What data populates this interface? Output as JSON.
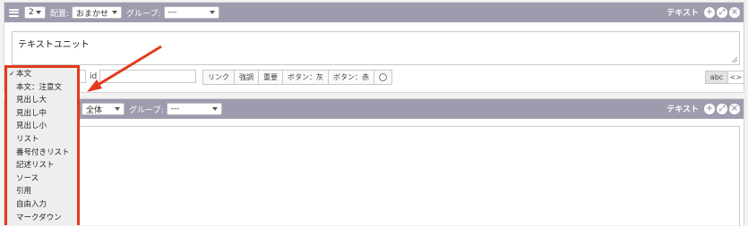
{
  "unit1": {
    "count": "2",
    "placement_label": "配置:",
    "placement_value": "おまかせ",
    "group_label": "グループ:",
    "group_value": "---",
    "title": "テキスト",
    "text": "テキストユニット",
    "id_label": "id",
    "tools": [
      "リンク",
      "強調",
      "重要",
      "ボタン：灰",
      "ボタン：赤"
    ],
    "mode_abc": "abc",
    "mode_code": "<>"
  },
  "unit2": {
    "placement_value": "全体",
    "group_label": "グループ:",
    "group_value": "---",
    "title": "テキスト"
  },
  "dropdown": {
    "selected_index": 0,
    "items": [
      "本文",
      "本文：注意文",
      "見出し大",
      "見出し中",
      "見出し小",
      "リスト",
      "番号付きリスト",
      "記述リスト",
      "ソース",
      "引用",
      "自由入力",
      "マークダウン"
    ]
  },
  "colors": {
    "toolbar": "#9d9caf",
    "highlight": "#e23b1e"
  },
  "icons": [
    "menu-icon",
    "plus-icon",
    "move-icon",
    "close-icon",
    "smiley-icon",
    "arrow-annotation"
  ]
}
